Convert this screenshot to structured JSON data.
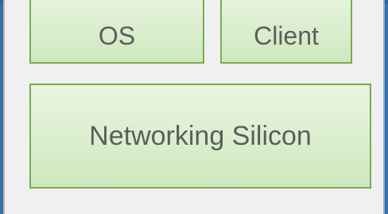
{
  "diagram": {
    "boxes": {
      "os": {
        "label": "OS"
      },
      "client": {
        "label": "Client"
      },
      "networking_silicon": {
        "label": "Networking Silicon"
      }
    }
  },
  "colors": {
    "box_fill_top": "#e8f5df",
    "box_fill_bottom": "#cfe8bf",
    "box_border": "#7aac52",
    "label_text": "#5d5d5d",
    "background": "#f0f0f0",
    "frame_blue": "#3a6fa8"
  }
}
